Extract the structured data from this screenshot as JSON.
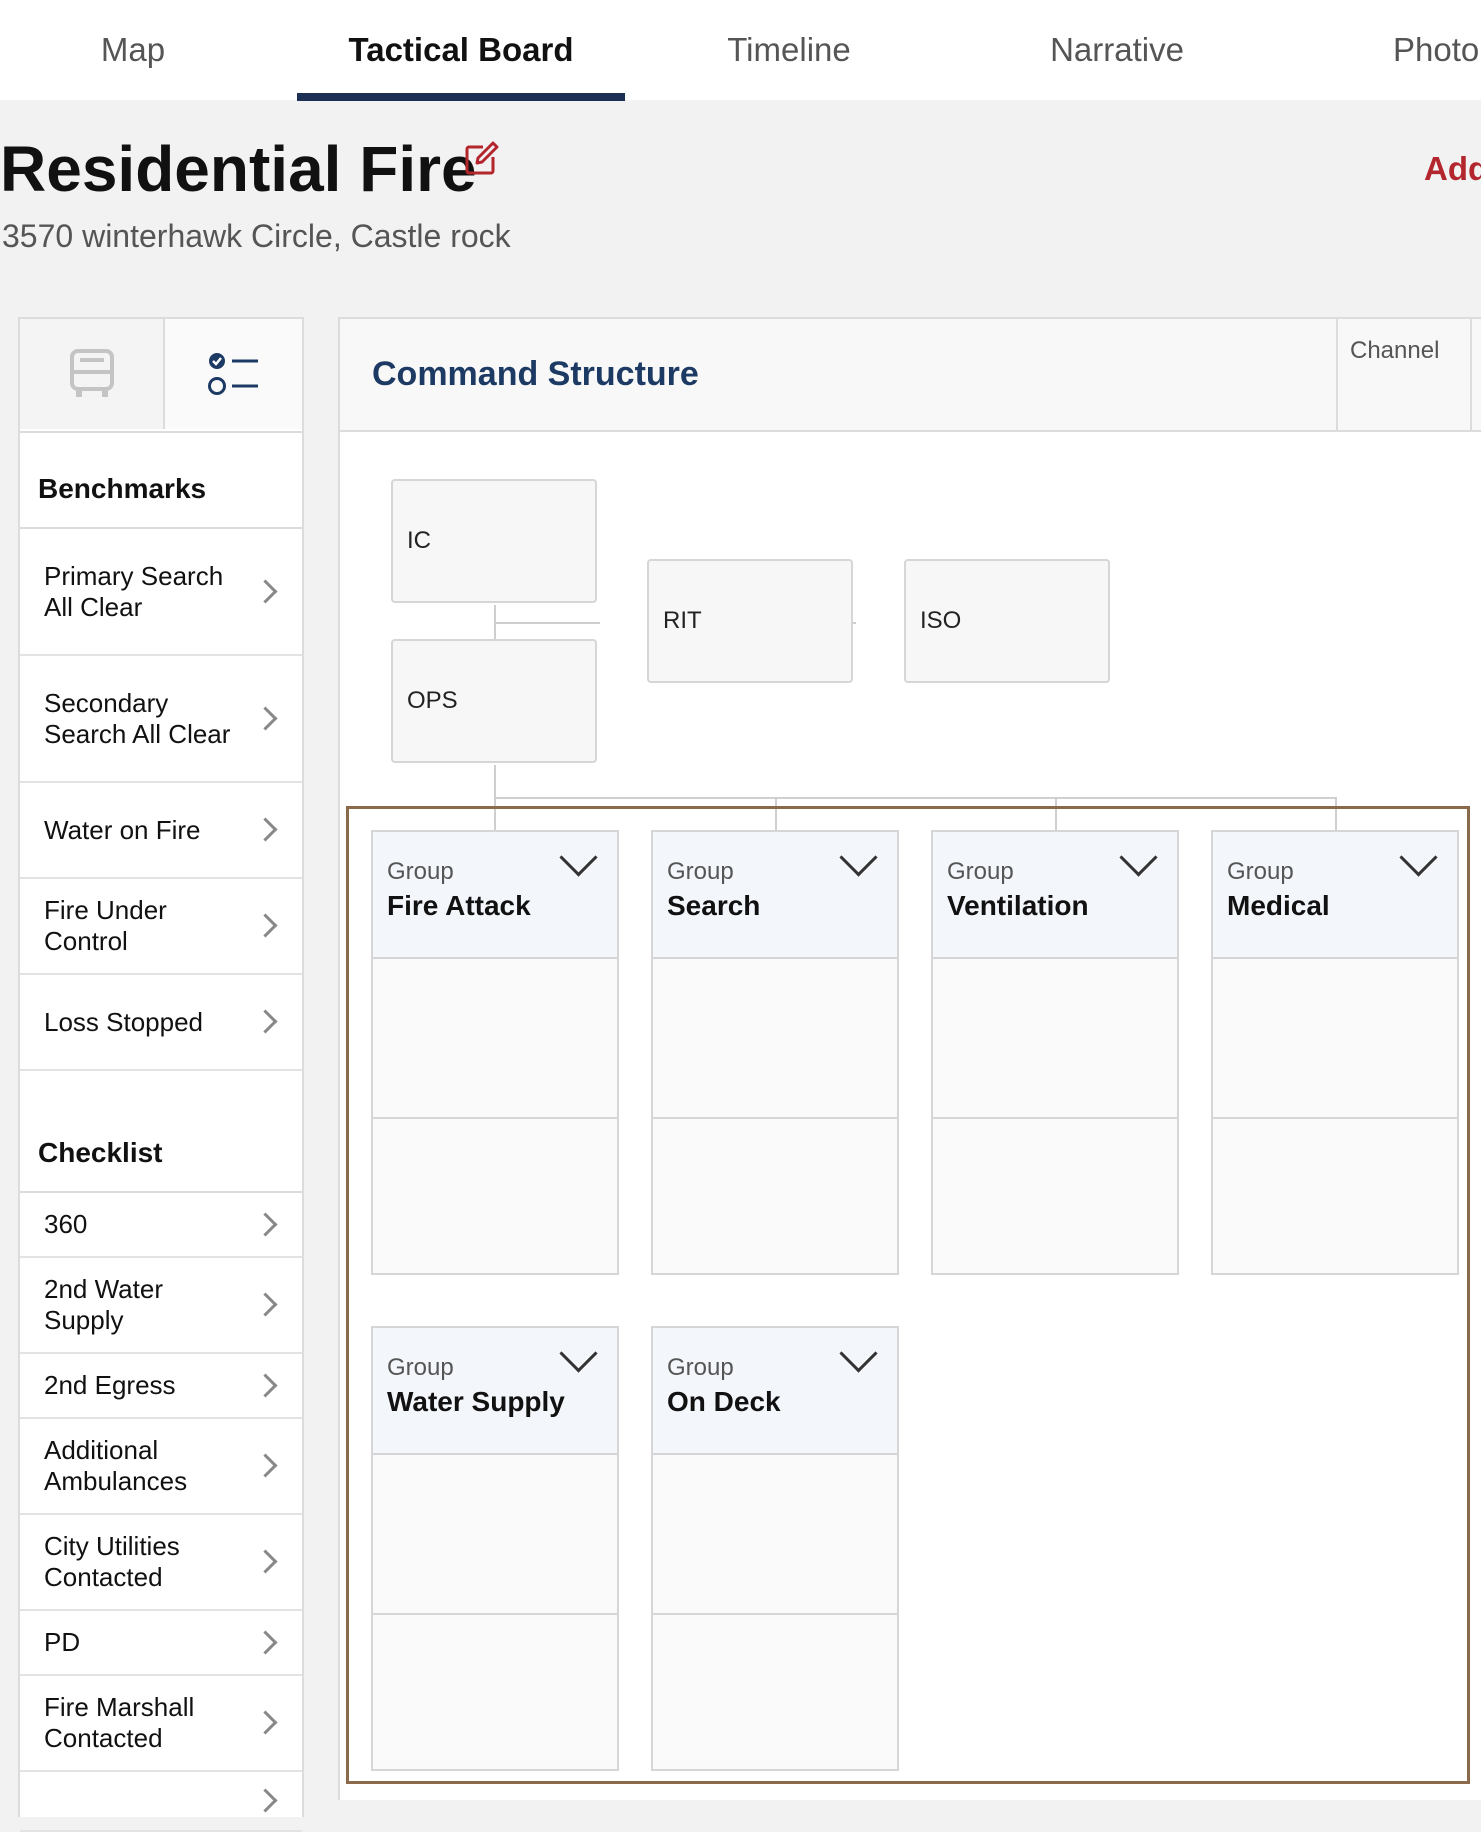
{
  "tabs": [
    "Map",
    "Tactical Board",
    "Timeline",
    "Narrative",
    "Photo"
  ],
  "active_tab": "Tactical Board",
  "incident": {
    "title": "Residential Fire",
    "address": "3570 winterhawk Circle, Castle rock"
  },
  "header_action": "Add",
  "left_panel": {
    "tab_icons": [
      "bus-icon",
      "checklist-icon"
    ],
    "benchmarks_title": "Benchmarks",
    "benchmarks": [
      "Primary Search All Clear",
      "Secondary Search All Clear",
      "Water on Fire",
      "Fire Under Control",
      "Loss Stopped"
    ],
    "checklist_title": "Checklist",
    "checklist": [
      "360",
      "2nd Water Supply",
      "2nd Egress",
      "Additional Ambulances",
      "City Utilities Contacted",
      "PD",
      "Fire Marshall Contacted"
    ]
  },
  "board": {
    "title": "Command Structure",
    "channel_label": "Channel",
    "nodes": [
      "IC",
      "RIT",
      "ISO",
      "OPS"
    ],
    "group_kicker": "Group",
    "groups": [
      "Fire Attack",
      "Search",
      "Ventilation",
      "Medical",
      "Water Supply",
      "On Deck"
    ]
  },
  "colors": {
    "active_tab_underline": "#1c2f55",
    "accent_red": "#b3262e",
    "board_title": "#1c3a63",
    "group_frame": "#8a6a4a"
  }
}
